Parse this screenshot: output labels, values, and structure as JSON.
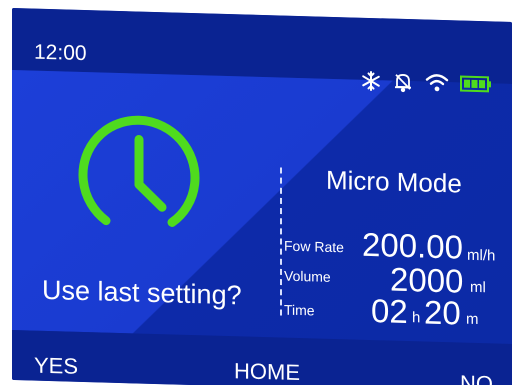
{
  "status_bar": {
    "time": "12:00",
    "icons": [
      "snowflake-icon",
      "bell-mute-icon",
      "wifi-icon",
      "battery-icon"
    ]
  },
  "main": {
    "mode_title": "Micro Mode",
    "prompt": "Use last setting?",
    "params": {
      "flow_rate": {
        "label": "Fow Rate",
        "value": "200.00",
        "unit": "ml/h"
      },
      "volume": {
        "label": "Volume",
        "value": "2000",
        "unit": "ml"
      },
      "time": {
        "label": "Time",
        "hours": "02",
        "hours_unit": "h",
        "minutes": "20",
        "minutes_unit": "m"
      }
    }
  },
  "softkeys": {
    "left": "YES",
    "center": "HOME",
    "right": "NO"
  },
  "colors": {
    "background": "#0f2aa6",
    "clock": "#4fdb1e",
    "text": "#ffffff",
    "battery": "#4fdb1e"
  }
}
